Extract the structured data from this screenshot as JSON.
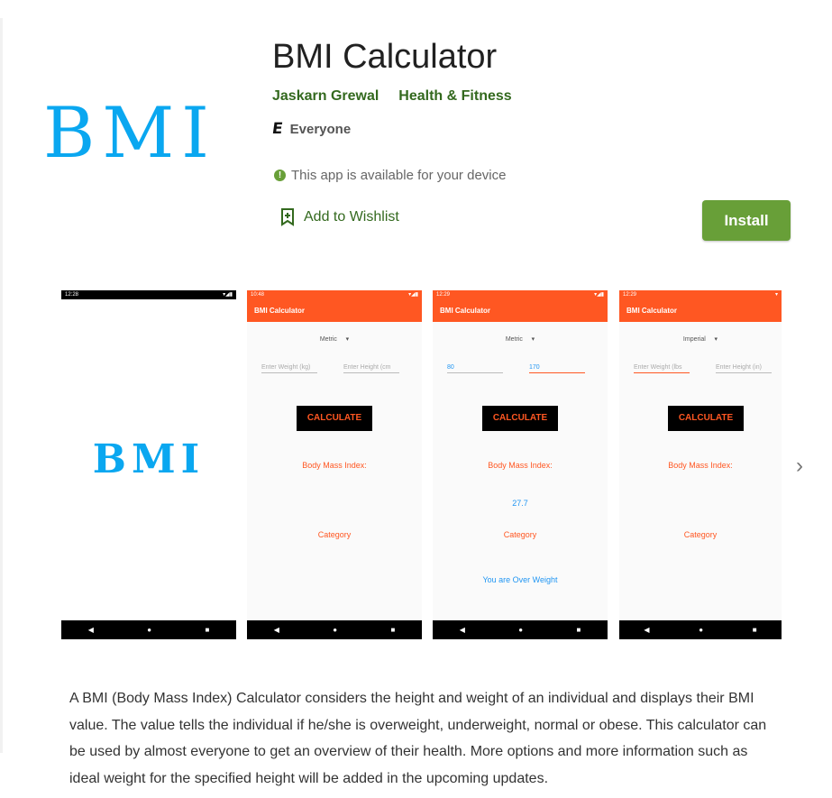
{
  "app": {
    "icon_text": "BMI",
    "title": "BMI Calculator",
    "developer": "Jaskarn Grewal",
    "category": "Health & Fitness",
    "content_rating_symbol": "E",
    "content_rating": "Everyone",
    "availability": "This app is available for your device",
    "wishlist_label": "Add to Wishlist",
    "install_label": "Install",
    "accent_color": "#689f38",
    "link_color": "#33691e"
  },
  "screenshots": [
    {
      "status_time": "12:28",
      "splash_text": "BMI"
    },
    {
      "status_time": "10:48",
      "app_bar": "BMI Calculator",
      "unit": "Metric",
      "weight_field": "Enter Weight (kg)",
      "height_field": "Enter Height (cm",
      "button": "CALCULATE",
      "bmi_label": "Body Mass Index:",
      "bmi_value": "",
      "category_label": "Category",
      "category_value": ""
    },
    {
      "status_time": "12:29",
      "app_bar": "BMI Calculator",
      "unit": "Metric",
      "weight_field": "80",
      "height_field": "170",
      "button": "CALCULATE",
      "bmi_label": "Body Mass Index:",
      "bmi_value": "27.7",
      "category_label": "Category",
      "category_value": "You are Over Weight"
    },
    {
      "status_time": "12:29",
      "app_bar": "BMI Calculator",
      "unit": "Imperial",
      "weight_field": "Enter Weight (lbs",
      "height_field": "Enter Height (in)",
      "button": "CALCULATE",
      "bmi_label": "Body Mass Index:",
      "bmi_value": "",
      "category_label": "Category",
      "category_value": ""
    }
  ],
  "description": "A BMI (Body Mass Index) Calculator considers the height and weight of an individual and displays their BMI value. The value tells the individual if he/she is overweight, underweight, normal or obese. This calculator can be used by almost everyone to get an overview of their health. More options and more information such as ideal weight for the specified height will be added in the upcoming updates.",
  "icons": {
    "next": "chevron-right-icon",
    "wishlist": "bookmark-add-icon",
    "info": "info-icon",
    "esrb": "esrb-everyone-icon"
  }
}
